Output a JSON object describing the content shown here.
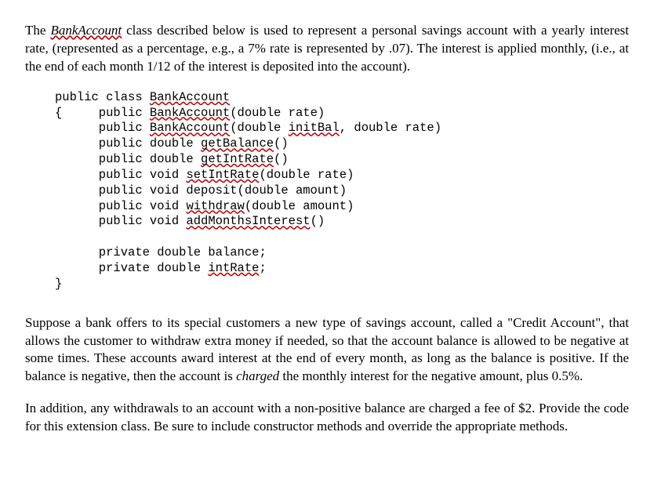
{
  "intro": {
    "part1": "The ",
    "classname": "BankAccount",
    "part2": " class described below is used to represent a personal savings account with a yearly interest rate, (represented as a percentage, e.g., a 7% rate is represented by .07). The interest is applied monthly, (i.e., at the end of each month 1/12 of the interest is deposited into the account)."
  },
  "code": {
    "l1a": "public class ",
    "l1b": "BankAccount",
    "l2a": "{     public ",
    "l2b": "BankAccount",
    "l2c": "(double rate)",
    "l3a": "      public ",
    "l3b": "BankAccount",
    "l3c": "(double ",
    "l3d": "initBal",
    "l3e": ", double rate)",
    "l4a": "      public double ",
    "l4b": "getBalance",
    "l4c": "()",
    "l5a": "      public double ",
    "l5b": "getIntRate",
    "l5c": "()",
    "l6a": "      public void ",
    "l6b": "setIntRate",
    "l6c": "(double rate)",
    "l7a": "      public void deposit(double amount)",
    "l8a": "      public void ",
    "l8b": "withdraw",
    "l8c": "(double amount)",
    "l9a": "      public void ",
    "l9b": "addMonthsInterest",
    "l9c": "()",
    "blank": "",
    "l10": "      private double balance;",
    "l11a": "      private double ",
    "l11b": "intRate",
    "l11c": ";",
    "l12": "}"
  },
  "para2": {
    "part1": "Suppose a bank offers to its special customers a new type of savings account, called a \"Credit Account\", that allows the customer to withdraw extra money if needed, so that the account balance is allowed to be negative at some times. These accounts award interest at the end of every month, as long as the balance is positive. If the balance is negative, then the account is ",
    "charged": "charged",
    "part2": " the monthly interest for the negative amount, plus 0.5%."
  },
  "para3": "In addition, any withdrawals to an account with a non-positive balance are charged a fee of $2. Provide the code for this extension class. Be sure to include constructor methods and override the appropriate methods."
}
